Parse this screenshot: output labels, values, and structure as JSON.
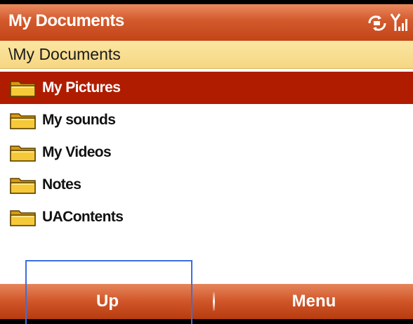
{
  "window": {
    "title": "My Documents"
  },
  "status_icons": [
    "network-sync-icon",
    "signal-strength-icon"
  ],
  "path": "\\My Documents",
  "folders": [
    {
      "label": "My Pictures",
      "selected": true,
      "icon": "folder-icon"
    },
    {
      "label": "My sounds",
      "selected": false,
      "icon": "folder-icon"
    },
    {
      "label": "My Videos",
      "selected": false,
      "icon": "folder-icon"
    },
    {
      "label": "Notes",
      "selected": false,
      "icon": "folder-icon"
    },
    {
      "label": "UAContents",
      "selected": false,
      "icon": "folder-icon"
    }
  ],
  "softkeys": {
    "left": "Up",
    "right": "Menu"
  },
  "colors": {
    "title_bar": "#d3592c",
    "path_bar": "#f6d682",
    "selection": "#b01c00",
    "folder": "#f2c12e",
    "highlight_box": "#3a6fe0"
  }
}
